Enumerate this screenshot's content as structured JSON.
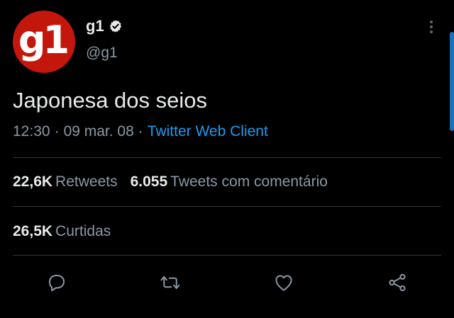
{
  "account": {
    "avatar_text": "g1",
    "display_name": "g1",
    "handle": "@g1",
    "avatar_color": "#c4170c",
    "verified": true
  },
  "tweet": {
    "text": "Japonesa dos seios",
    "time": "12:30",
    "separator": "·",
    "date": "09 mar. 08",
    "client": "Twitter Web Client"
  },
  "stats": {
    "retweets_count": "22,6K",
    "retweets_label": "Retweets",
    "quotes_count": "6.055",
    "quotes_label": "Tweets com comentário",
    "likes_count": "26,5K",
    "likes_label": "Curtidas"
  },
  "actions": {
    "icons": [
      "reply-icon",
      "retweet-icon",
      "like-icon",
      "share-icon"
    ]
  },
  "colors": {
    "background": "#000000",
    "text": "#e7e9ea",
    "muted": "#8b98a5",
    "link": "#1d9bf0",
    "divider": "#2f3336",
    "brand": "#c4170c"
  }
}
